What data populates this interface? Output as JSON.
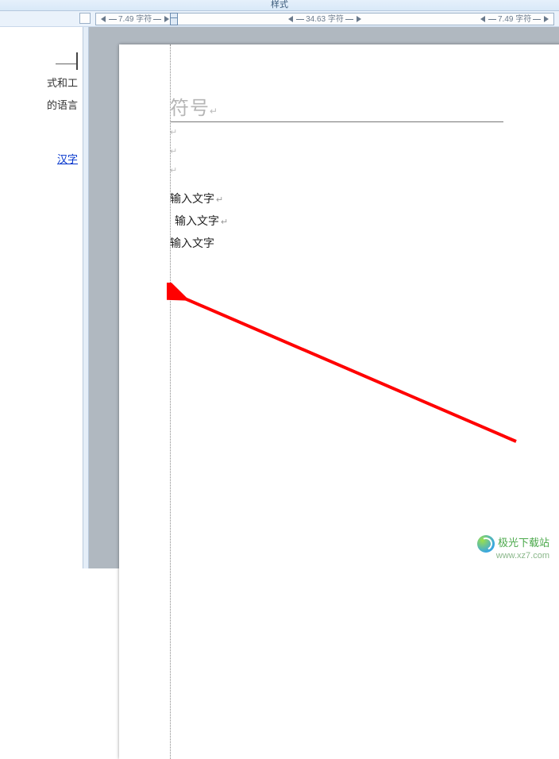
{
  "ribbon": {
    "group_label": "样式"
  },
  "ruler": {
    "left_segment": "7.49 字符",
    "center_segment": "34.63 字符",
    "right_segment": "7.49 字符"
  },
  "task_pane": {
    "line1": "式和工",
    "line2": "的语言",
    "link": "汉字"
  },
  "document": {
    "title_placeholder": "符号",
    "lines": [
      "输入文字",
      "输入文字",
      "输入文字"
    ]
  },
  "watermark": {
    "name": "极光下载站",
    "url": "www.xz7.com"
  }
}
